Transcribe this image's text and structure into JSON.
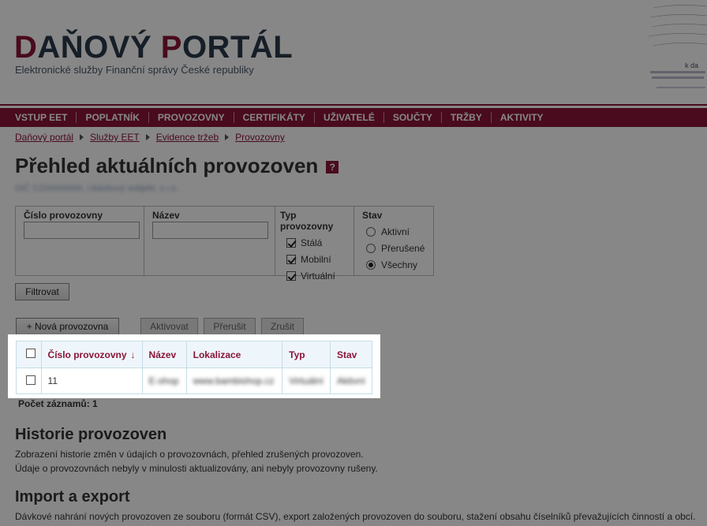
{
  "header": {
    "title_first_letter": "D",
    "title_part1": "AŇOVÝ ",
    "title_second_letter": "P",
    "title_part2": "ORTÁL",
    "subtitle": "Elektronické služby Finanční správy České republiky",
    "seal_text": "k da"
  },
  "nav": {
    "items": [
      "VSTUP EET",
      "POPLATNÍK",
      "PROVOZOVNY",
      "CERTIFIKÁTY",
      "UŽIVATELÉ",
      "SOUČTY",
      "TRŽBY",
      "AKTIVITY"
    ]
  },
  "breadcrumb": [
    "Daňový portál",
    "Služby EET",
    "Evidence tržeb",
    "Provozovny"
  ],
  "page": {
    "title": "Přehled aktuálních provozoven",
    "help": "?",
    "subject": "DIČ CZ00000000, Ukázkový subjekt, s.r.o."
  },
  "filter": {
    "col1_label": "Číslo provozovny",
    "col1_value": "",
    "col2_label": "Název",
    "col2_value": "",
    "type_label": "Typ provozovny",
    "types": [
      {
        "label": "Stálá",
        "checked": true
      },
      {
        "label": "Mobilní",
        "checked": true
      },
      {
        "label": "Virtuální",
        "checked": true
      }
    ],
    "state_label": "Stav",
    "states": [
      {
        "label": "Aktivní",
        "selected": false
      },
      {
        "label": "Přerušené",
        "selected": false
      },
      {
        "label": "Všechny",
        "selected": true
      }
    ],
    "button": "Filtrovat"
  },
  "actions": {
    "new": "+ Nová provozovna",
    "activate": "Aktivovat",
    "interrupt": "Přerušit",
    "cancel": "Zrušit"
  },
  "table": {
    "headers": [
      "Číslo provozovny",
      "Název",
      "Lokalizace",
      "Typ",
      "Stav"
    ],
    "sort_indicator": "↓",
    "rows": [
      {
        "number": "11",
        "name": "E-shop",
        "location": "www.bambishop.cz",
        "type": "Virtuální",
        "state": "Aktivní"
      }
    ],
    "count_label": "Počet záznamů: 1"
  },
  "history": {
    "title": "Historie provozoven",
    "line1": "Zobrazení historie změn v údajích o provozovnách, přehled zrušených provozoven.",
    "line2": "Údaje o provozovnách nebyly v minulosti aktualizovány, ani nebyly provozovny rušeny."
  },
  "import": {
    "title": "Import a export",
    "line1": "Dávkové nahrání nových provozoven ze souboru (formát CSV), export založených provozoven do souboru, stažení obsahu číselníků převažujících činností a obcí."
  },
  "colors": {
    "brand": "#8a1538",
    "dark": "#2a3a4a",
    "table_header_bg": "#eef6fb",
    "table_border": "#c6dce8"
  }
}
